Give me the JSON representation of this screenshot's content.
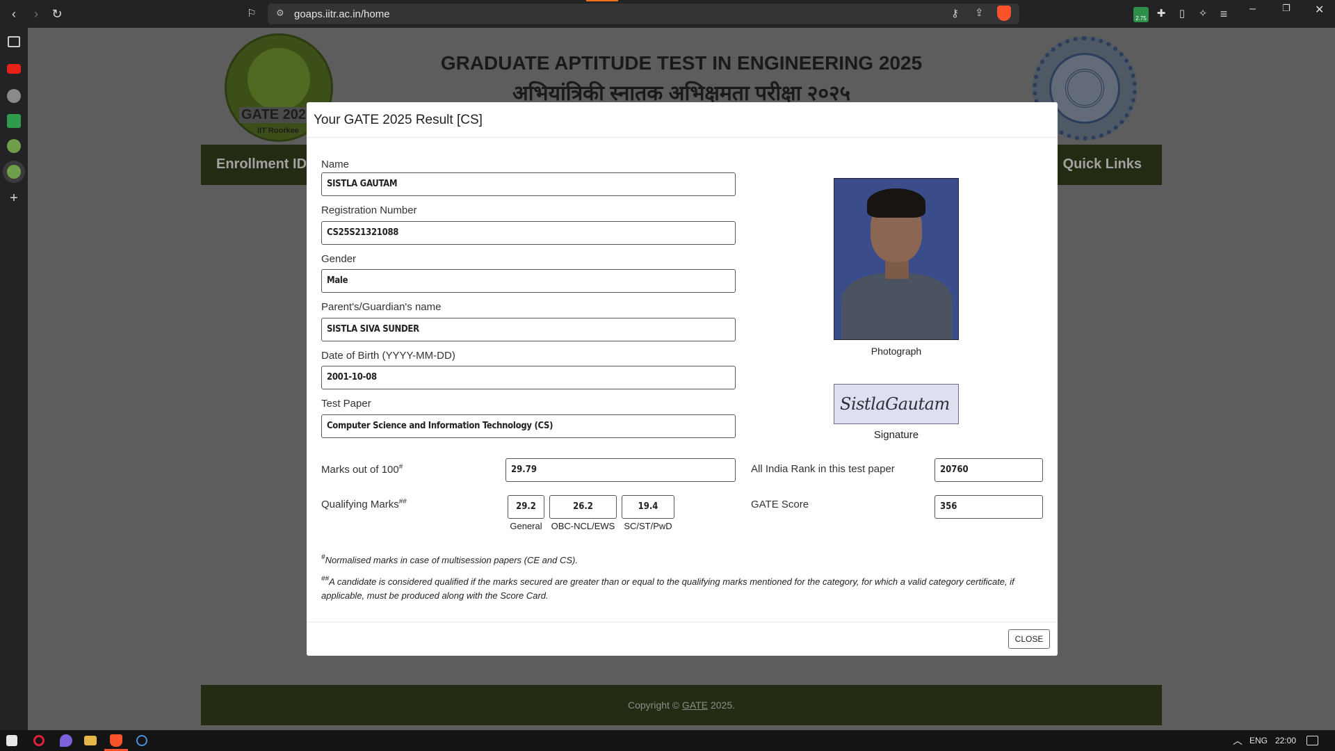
{
  "browser": {
    "url": "goaps.iitr.ac.in/home",
    "extension_badge": "2.75"
  },
  "page": {
    "header_title_en": "GRADUATE APTITUDE TEST IN ENGINEERING 2025",
    "header_title_hi": "अभियांत्रिकी स्नातक अभिक्षमता परीक्षा २०२५",
    "logo_text": "GATE 202",
    "logo_sub": "IIT Roorkee",
    "nav_enrollment": "Enrollment ID:",
    "nav_quick_links": "Quick Links",
    "footer_prefix": "Copyright ©",
    "footer_link": "GATE",
    "footer_suffix": "2025."
  },
  "modal": {
    "title": "Your GATE 2025 Result [CS]",
    "fields": {
      "name_label": "Name",
      "name_value": "SISTLA GAUTAM",
      "reg_label": "Registration Number",
      "reg_value": "CS25S21321088",
      "gender_label": "Gender",
      "gender_value": "Male",
      "guardian_label": "Parent's/Guardian's name",
      "guardian_value": "SISTLA SIVA SUNDER",
      "dob_label": "Date of Birth (YYYY-MM-DD)",
      "dob_value": "2001-10-08",
      "paper_label": "Test Paper",
      "paper_value": "Computer Science and Information Technology (CS)"
    },
    "photo_caption": "Photograph",
    "signature_text": "SistlaGautam",
    "signature_caption": "Signature",
    "scores": {
      "marks_label": "Marks out of 100",
      "marks_sup": "#",
      "marks_value": "29.79",
      "air_label": "All India Rank in this test paper",
      "air_value": "20760",
      "qual_label": "Qualifying Marks",
      "qual_sup": "##",
      "qual_general": "29.2",
      "qual_obc": "26.2",
      "qual_sc": "19.4",
      "cap_general": "General",
      "cap_obc": "OBC-NCL/EWS",
      "cap_sc": "SC/ST/PwD",
      "gate_score_label": "GATE Score",
      "gate_score_value": "356"
    },
    "notes": {
      "note1_sup": "#",
      "note1": "Normalised marks in case of multisession papers (CE and CS).",
      "note2_sup": "##",
      "note2": "A candidate is considered qualified if the marks secured are greater than or equal to the qualifying marks mentioned for the category, for which a valid category certificate, if applicable, must be produced along with the Score Card."
    },
    "close_label": "CLOSE"
  },
  "taskbar": {
    "lang": "ENG",
    "time": "22:00"
  }
}
